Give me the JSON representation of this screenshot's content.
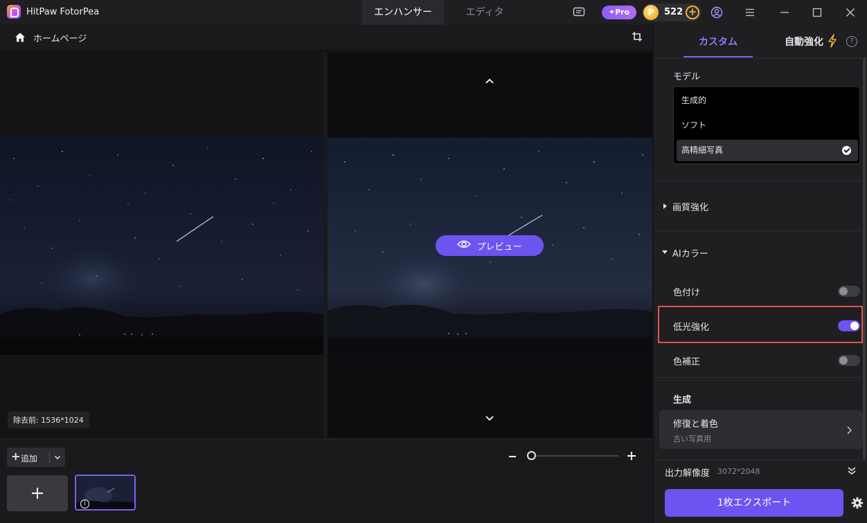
{
  "app": {
    "title": "HitPaw FotorPea",
    "mode_tabs": [
      {
        "label": "エンハンサー",
        "active": true
      },
      {
        "label": "エディタ",
        "active": false
      }
    ],
    "pro_label": "✦Pro",
    "coins": {
      "icon_letter": "P",
      "count": "522"
    }
  },
  "nav": {
    "home_label": "ホームページ"
  },
  "viewer": {
    "preview_label": "プレビュー",
    "size_tag": "除去前: 1536*1024"
  },
  "bottom": {
    "add_label": "追加"
  },
  "panel": {
    "tabs": {
      "custom": "カスタム",
      "auto": "自動強化"
    },
    "help_glyph": "?",
    "model": {
      "label": "モデル",
      "options": [
        {
          "label": "生成的",
          "selected": false
        },
        {
          "label": "ソフト",
          "selected": false
        },
        {
          "label": "高精細写真",
          "selected": true
        }
      ]
    },
    "quality_section": "画質強化",
    "ai_color": {
      "label": "AIカラー",
      "toggles": [
        {
          "label": "色付け",
          "on": false
        },
        {
          "label": "低光強化",
          "on": true
        },
        {
          "label": "色補正",
          "on": false
        }
      ]
    },
    "generate": {
      "label": "生成",
      "card_title": "修復と着色",
      "card_subtitle": "古い写真用"
    },
    "output": {
      "label": "出力解像度",
      "value": "3072*2048"
    },
    "export_label": "1枚エクスポート"
  },
  "colors": {
    "accent": "#6c54f0",
    "highlight": "#e0544a",
    "panel_bg": "#1f1f22"
  }
}
